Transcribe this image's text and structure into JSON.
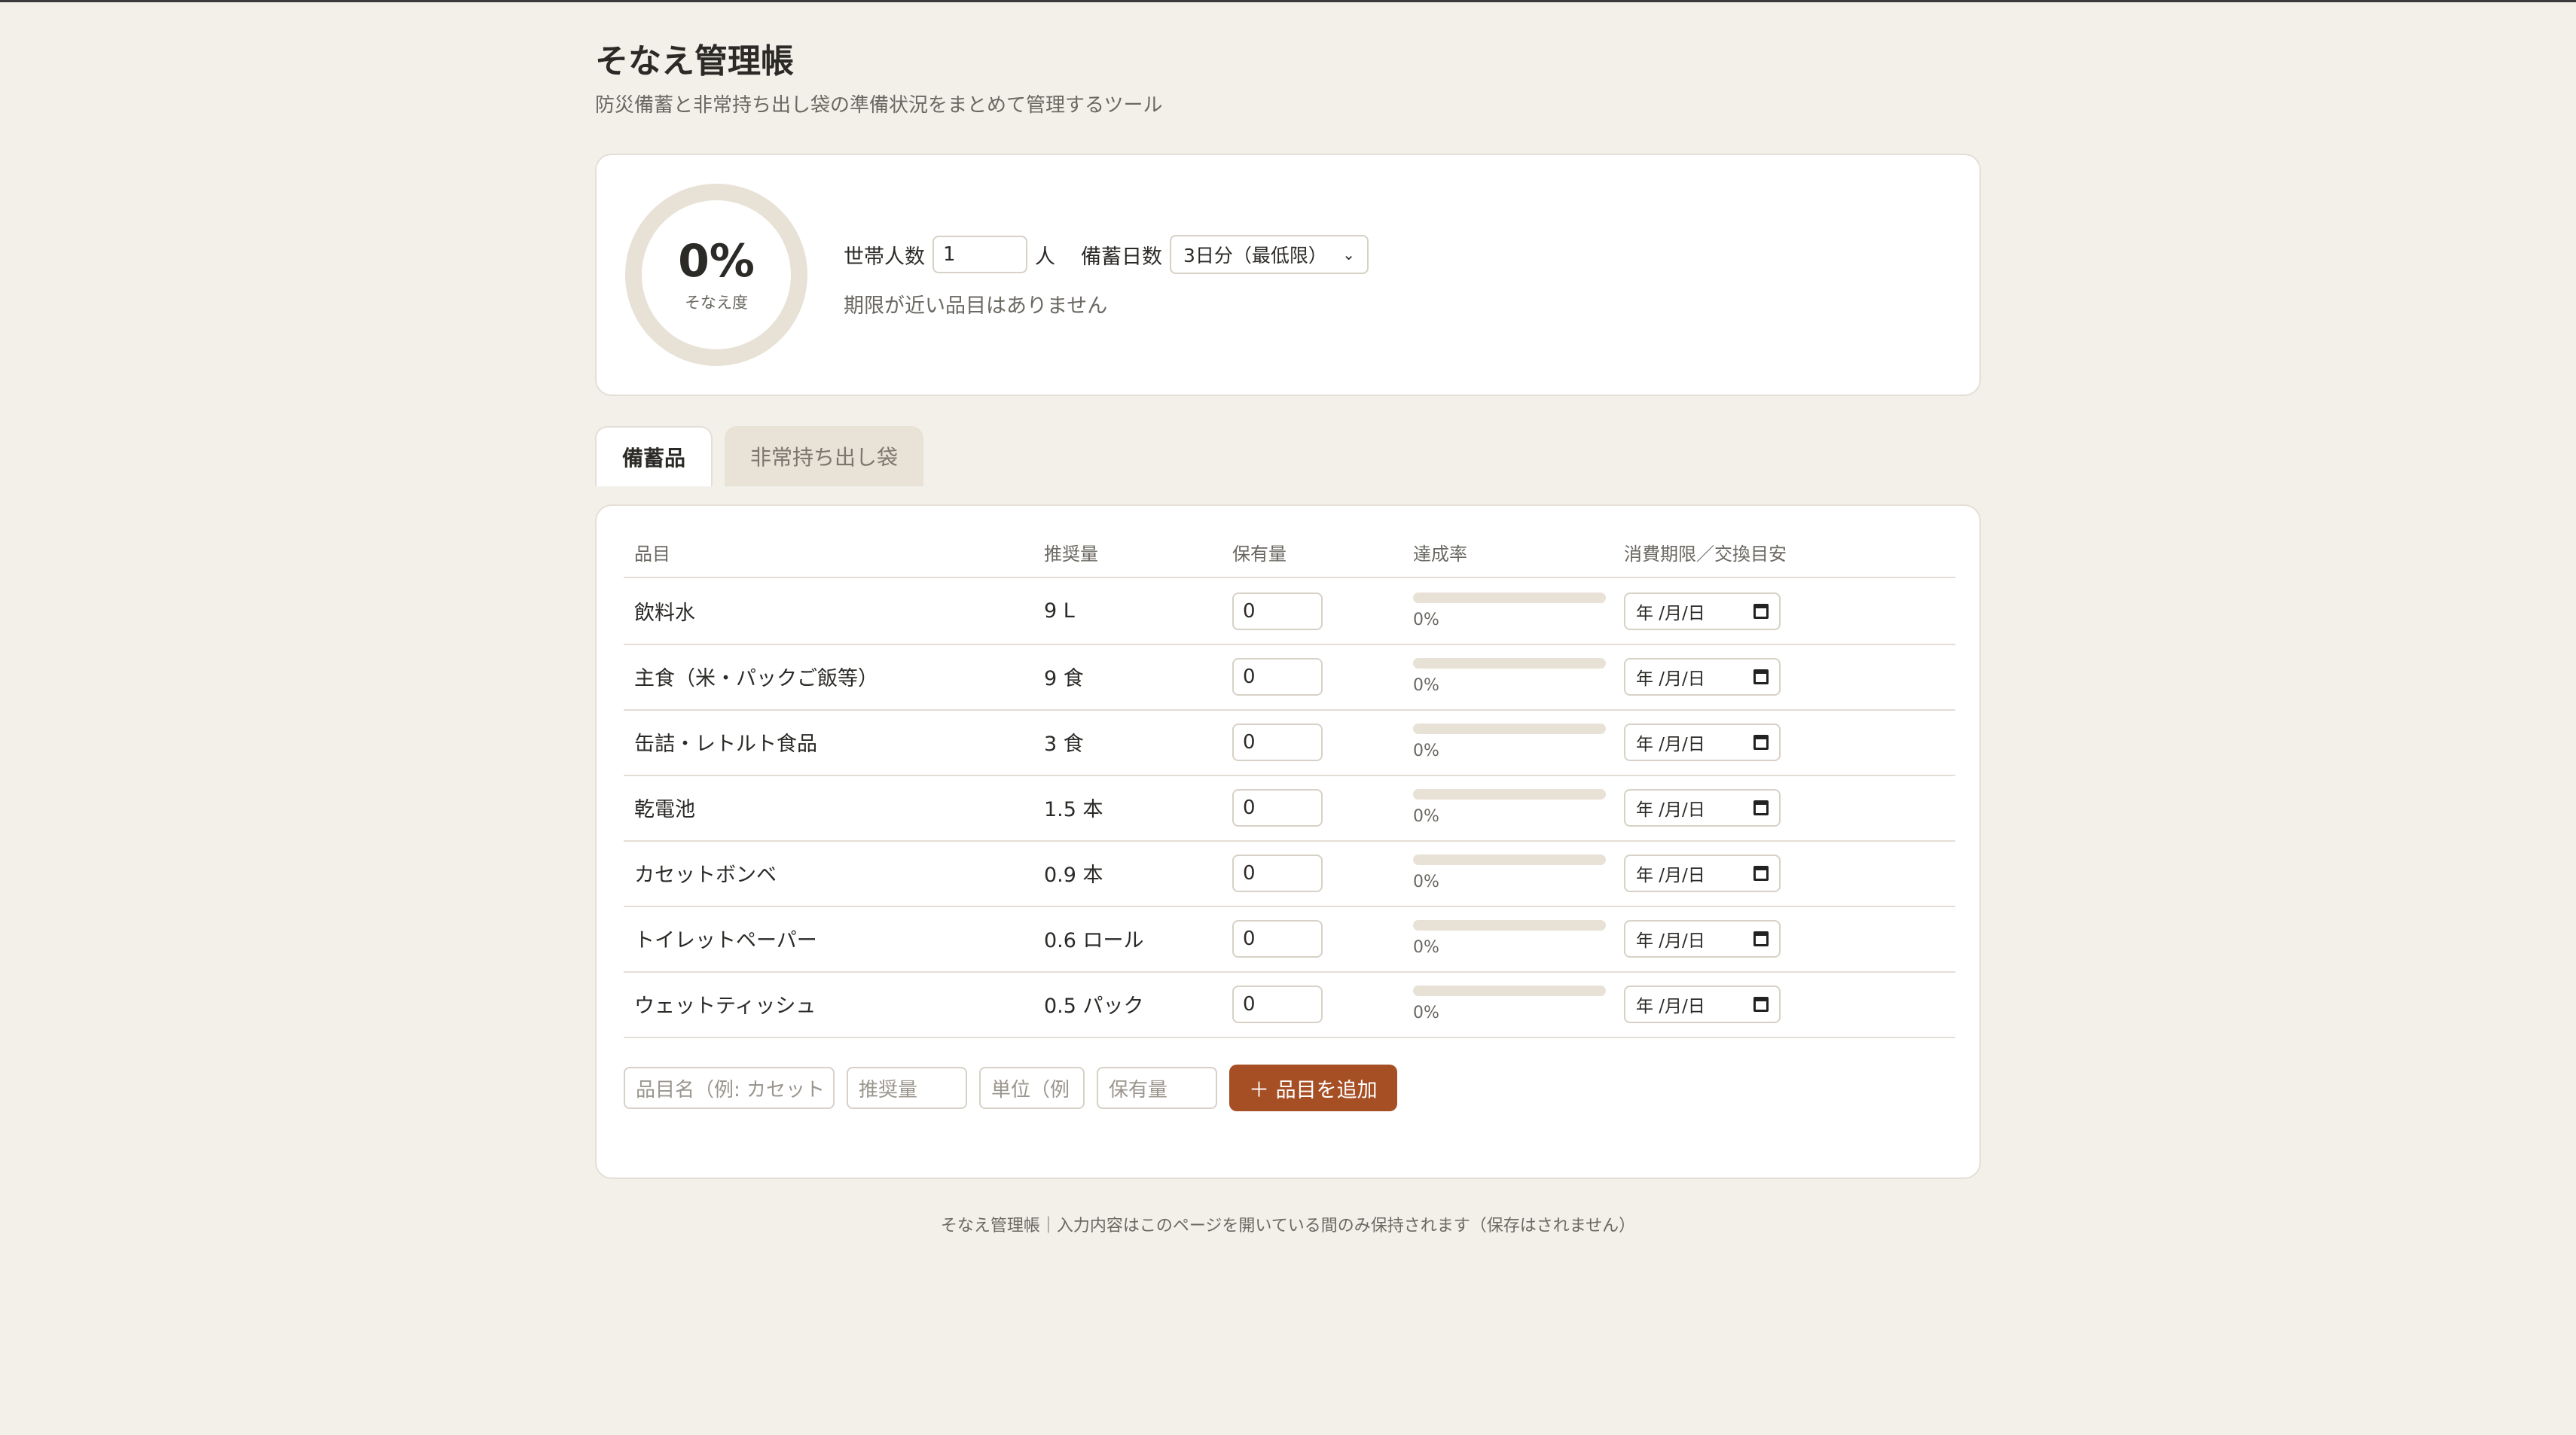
{
  "header": {
    "title": "そなえ管理帳",
    "subtitle": "防災備蓄と非常持ち出し袋の準備状況をまとめて管理するツール"
  },
  "summary": {
    "readiness_percent": "0%",
    "readiness_label": "そなえ度",
    "household_label": "世帯人数",
    "household_value": "1",
    "household_unit": "人",
    "days_label": "備蓄日数",
    "days_selected": "3日分（最低限）",
    "expiry_note": "期限が近い品目はありません"
  },
  "tabs": [
    {
      "label": "備蓄品",
      "active": true
    },
    {
      "label": "非常持ち出し袋",
      "active": false
    }
  ],
  "table": {
    "columns": [
      "品目",
      "推奨量",
      "保有量",
      "達成率",
      "消費期限／交換目安"
    ],
    "date_placeholder": "年 /月/日",
    "rows": [
      {
        "item": "飲料水",
        "recommended": "9 L",
        "owned": "0",
        "rate": "0%",
        "rate_value": 0
      },
      {
        "item": "主食（米・パックご飯等）",
        "recommended": "9 食",
        "owned": "0",
        "rate": "0%",
        "rate_value": 0
      },
      {
        "item": "缶詰・レトルト食品",
        "recommended": "3 食",
        "owned": "0",
        "rate": "0%",
        "rate_value": 0
      },
      {
        "item": "乾電池",
        "recommended": "1.5 本",
        "owned": "0",
        "rate": "0%",
        "rate_value": 0
      },
      {
        "item": "カセットボンベ",
        "recommended": "0.9 本",
        "owned": "0",
        "rate": "0%",
        "rate_value": 0
      },
      {
        "item": "トイレットペーパー",
        "recommended": "0.6 ロール",
        "owned": "0",
        "rate": "0%",
        "rate_value": 0
      },
      {
        "item": "ウェットティッシュ",
        "recommended": "0.5 パック",
        "owned": "0",
        "rate": "0%",
        "rate_value": 0
      }
    ]
  },
  "add_form": {
    "name_placeholder": "品目名（例: カセット",
    "recommended_placeholder": "推奨量",
    "unit_placeholder": "単位（例",
    "owned_placeholder": "保有量",
    "add_button": "＋ 品目を追加"
  },
  "footer": "そなえ管理帳｜入力内容はこのページを開いている間のみ保持されます（保存はされません）",
  "colors": {
    "accent": "#a64f25",
    "background": "#f3f0ea",
    "ring": "#e8e1d6"
  }
}
